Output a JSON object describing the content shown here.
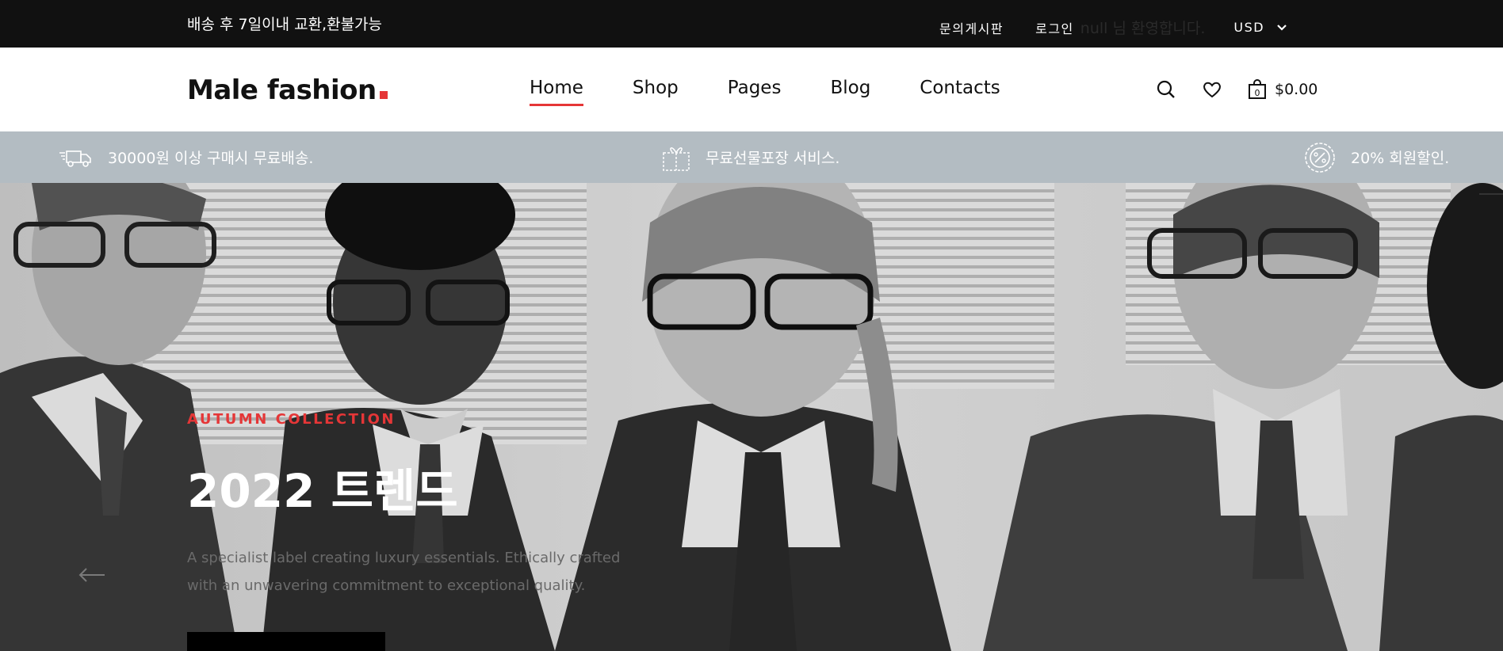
{
  "topbar": {
    "notice": "배송 후 7일이내 교환,환불가능",
    "board": "문의게시판",
    "login": "로그인",
    "welcome": "null 님 환영합니다.",
    "currency": "USD"
  },
  "header": {
    "logo_text": "Male fashion",
    "nav": [
      "Home",
      "Shop",
      "Pages",
      "Blog",
      "Contacts"
    ],
    "active_nav": "Home",
    "cart_count": "0",
    "cart_total": "$0.00"
  },
  "benefits": [
    {
      "icon": "truck-icon",
      "text": "30000원 이상 구매시 무료배송."
    },
    {
      "icon": "gift-icon",
      "text": "무료선물포장 서비스."
    },
    {
      "icon": "discount-badge-icon",
      "text": "20% 회원할인."
    }
  ],
  "hero": {
    "subtitle": "AUTUMN COLLECTION",
    "title": "2022 트렌드",
    "desc_line1": "A specialist label creating luxury essentials. Ethically crafted",
    "desc_line2": "with an unwavering commitment to exceptional quality."
  },
  "colors": {
    "accent": "#e53637",
    "topbar_bg": "#111111",
    "benefit_bg": "#b3bcc2"
  }
}
